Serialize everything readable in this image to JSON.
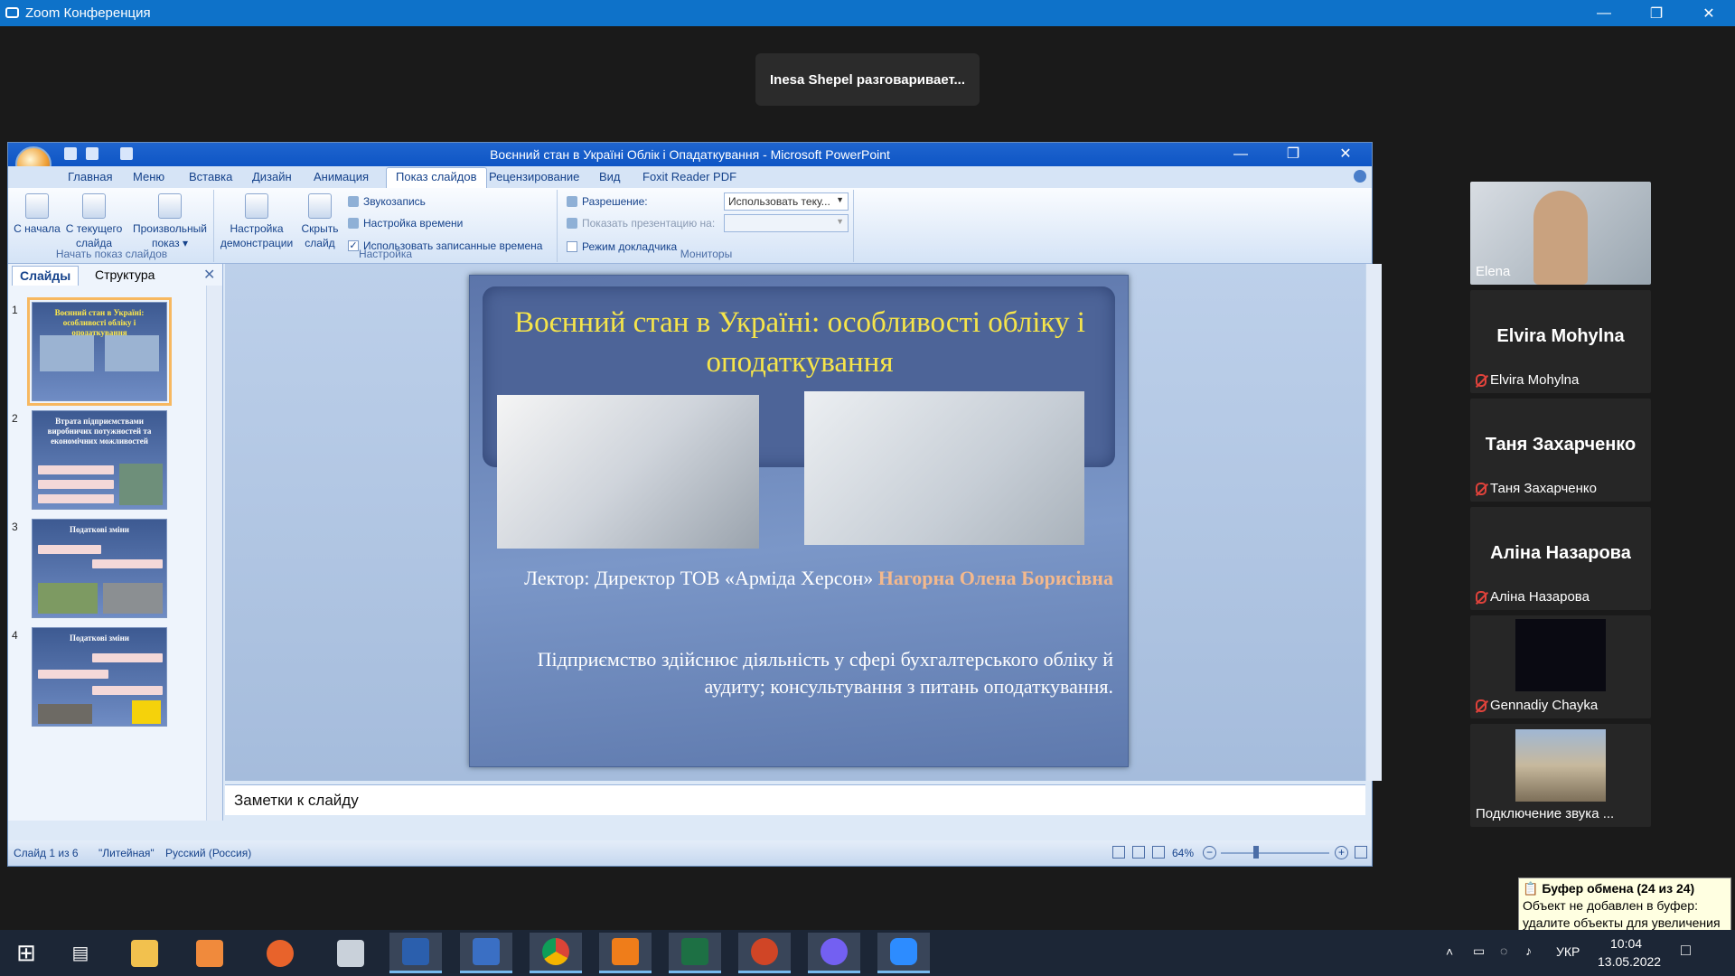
{
  "zoom": {
    "title": "Zoom Конференция",
    "speaker_banner": "Inesa Shepel разговаривает..."
  },
  "ppt": {
    "window_title": "Воєнний стан в Україні Облік і Опадаткування  -  Microsoft PowerPoint",
    "tabs": [
      "Главная",
      "Меню",
      "Вставка",
      "Дизайн",
      "Анимация",
      "Показ слайдов",
      "Рецензирование",
      "Вид",
      "Foxit Reader PDF"
    ],
    "active_tab": "Показ слайдов",
    "ribbon": {
      "start_group": "Начать показ слайдов",
      "btn_from_start": "С начала",
      "btn_from_current": "С текущего слайда",
      "btn_custom_show": "Произвольный показ",
      "setup_group": "Настройка",
      "btn_setup_show": "Настройка демонстрации",
      "btn_hide_slide": "Скрыть слайд",
      "rec_narration": "Звукозапись",
      "rehearse_timings": "Настройка времени",
      "use_timings": "Использовать записанные времена",
      "monitors_group": "Мониторы",
      "resolution_label": "Разрешение:",
      "resolution_value": "Использовать теку...",
      "show_on_label": "Показать презентацию на:",
      "presenter_view": "Режим докладчика"
    },
    "pane": {
      "tab_slides": "Слайды",
      "tab_outline": "Структура",
      "thumbnails": [
        {
          "num": "1",
          "title": "Воєнний стан в Україні: особливості обліку і оподаткування"
        },
        {
          "num": "2",
          "title": "Втрата підприємствами виробничих потужностей та економічних можливостей"
        },
        {
          "num": "3",
          "title": "Податкові зміни"
        },
        {
          "num": "4",
          "title": "Податкові зміни"
        }
      ]
    },
    "slide": {
      "title": "Воєнний стан в Україні: особливості обліку і оподаткування",
      "lecturer_prefix": "Лектор: Директор ТОВ «Арміда Херсон» ",
      "lecturer_name": "Нагорна Олена Борисівна",
      "description": "Підприємство здійснює діяльність у сфері бухгалтерського обліку й аудиту; консультування з питань оподаткування."
    },
    "notes_placeholder": "Заметки к слайду",
    "status": {
      "slide_count": "Слайд 1 из 6",
      "theme": "\"Литейная\"",
      "language": "Русский (Россия)",
      "zoom": "64%"
    }
  },
  "participants": [
    {
      "name": "Elena",
      "big": ""
    },
    {
      "name": "Elvira Mohylna",
      "big": "Elvira Mohylna"
    },
    {
      "name": "Таня Захарченко",
      "big": "Таня Захарченко"
    },
    {
      "name": "Аліна Назарова",
      "big": "Аліна Назарова"
    },
    {
      "name": "Gennadiy Chayka",
      "big": ""
    },
    {
      "name": "Подключение звука ...",
      "big": ""
    }
  ],
  "clipboard": {
    "title": "Буфер обмена (24 из 24)",
    "message": "Объект не добавлен в буфер: удалите объекты для увеличения доступного места"
  },
  "taskbar": {
    "lang": "УКР",
    "time": "10:04",
    "date": "13.05.2022"
  },
  "colors": {
    "zoom_blue": "#0e72c9",
    "slide_title": "#f6e54a",
    "lecturer_name": "#f4b98d",
    "mute_red": "#e0423b"
  }
}
